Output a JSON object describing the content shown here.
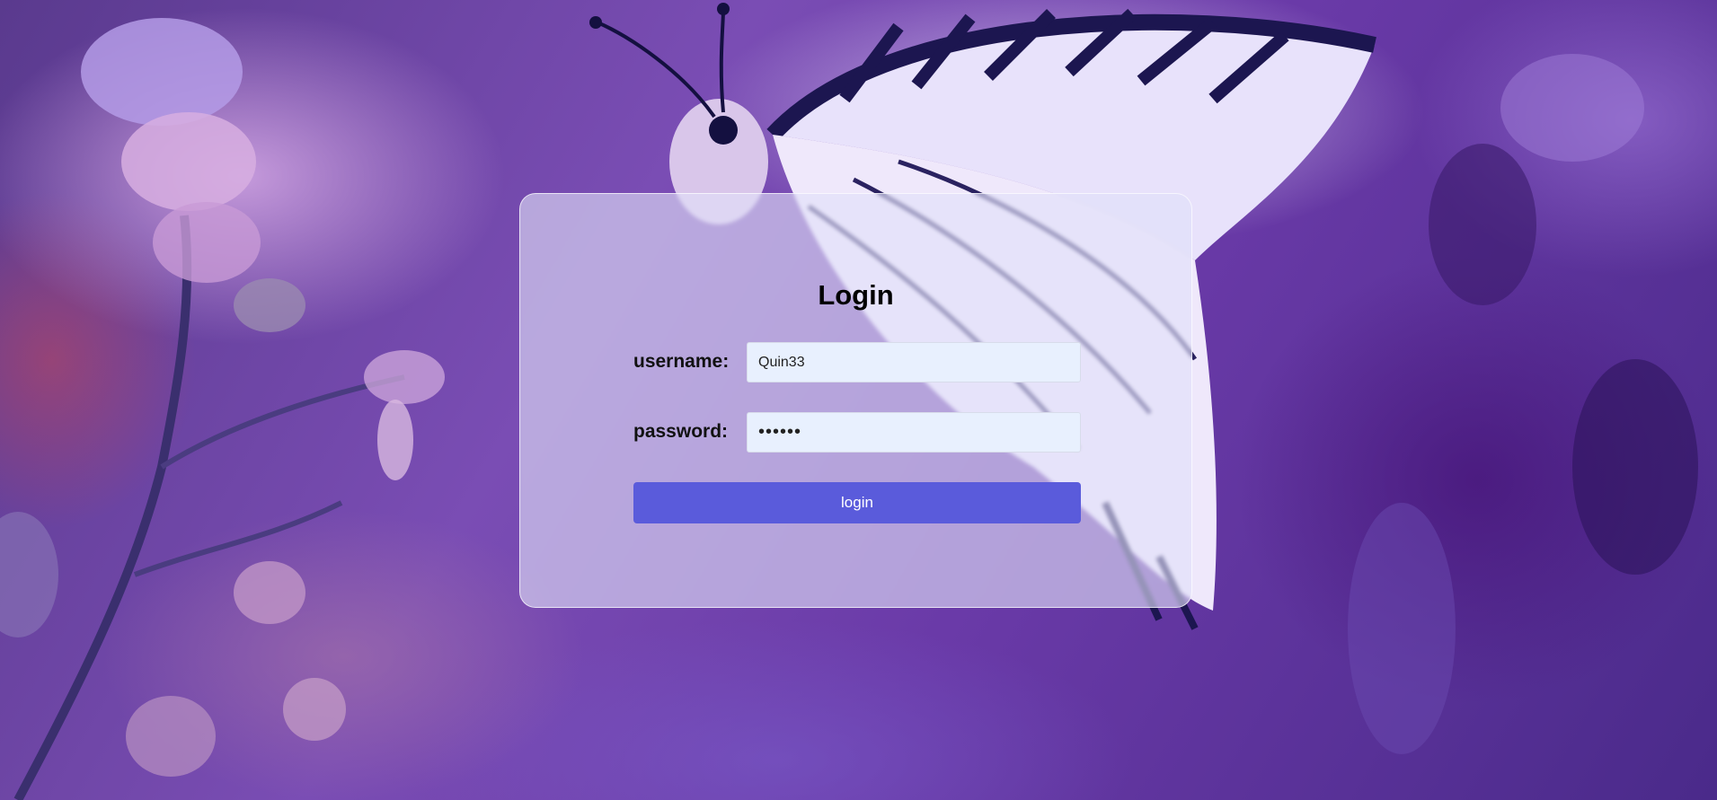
{
  "login_form": {
    "title": "Login",
    "username_label": "username:",
    "username_value": "Quin33",
    "password_label": "password:",
    "password_value": "••••••",
    "login_button_label": "login"
  },
  "colors": {
    "button": "#5a5bdb",
    "input_background": "#e8f0fe",
    "card_background": "rgba(225,225,248,0.62)"
  }
}
